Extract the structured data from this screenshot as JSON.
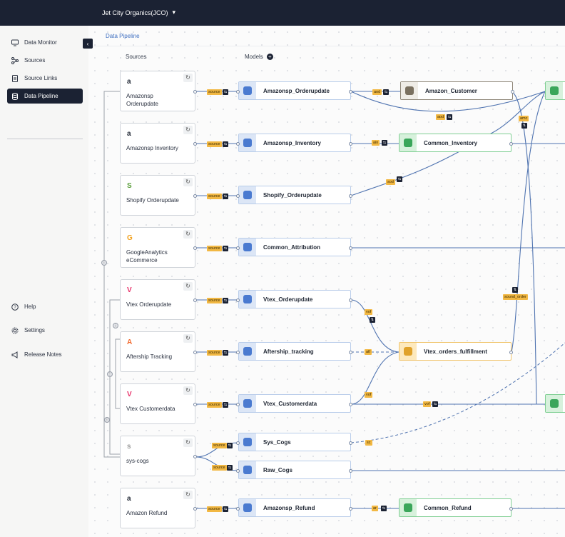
{
  "header": {
    "org_name": "Jet City Organics(JCO)"
  },
  "sidebar": {
    "items": [
      {
        "label": "Data Monitor",
        "icon": "monitor-icon"
      },
      {
        "label": "Sources",
        "icon": "sources-icon"
      },
      {
        "label": "Source Links",
        "icon": "document-icon"
      },
      {
        "label": "Data Pipeline",
        "icon": "database-icon",
        "active": true
      }
    ],
    "bottom": [
      {
        "label": "Help",
        "icon": "help-icon"
      },
      {
        "label": "Settings",
        "icon": "gear-icon"
      },
      {
        "label": "Release Notes",
        "icon": "megaphone-icon"
      }
    ]
  },
  "breadcrumb": "Data Pipeline",
  "columns": {
    "sources": "Sources",
    "models": "Models"
  },
  "sources": [
    {
      "name": "Amazonsp Orderupdate",
      "logo": "a"
    },
    {
      "name": "Amazonsp Inventory",
      "logo": "a"
    },
    {
      "name": "Shopify Orderupdate",
      "logo": "S"
    },
    {
      "name": "GoogleAnalytics eCommerce",
      "logo": "G"
    },
    {
      "name": "Vtex Orderupdate",
      "logo": "V"
    },
    {
      "name": "Aftership Tracking",
      "logo": "A"
    },
    {
      "name": "Vtex Customerdata",
      "logo": "V"
    },
    {
      "name": "sys-cogs",
      "logo": "s"
    },
    {
      "name": "Amazon Refund",
      "logo": "a"
    }
  ],
  "models": [
    "Amazonsp_Orderupdate",
    "Amazonsp_Inventory",
    "Shopify_Orderupdate",
    "Common_Attribution",
    "Vtex_Orderupdate",
    "Aftership_tracking",
    "Vtex_Customerdata",
    "Sys_Cogs",
    "Raw_Cogs",
    "Amazonsp_Refund"
  ],
  "downstream": {
    "amazon_customer": "Amazon_Customer",
    "common_inventory": "Common_Inventory",
    "vtex_orders_fulfillment": "Vtex_orders_fulfillment",
    "common_refund": "Common_Refund"
  },
  "tags": {
    "source": "source",
    "aod": "aod",
    "ain": "ain",
    "sod": "sod",
    "amc": "amc",
    "vof": "vof",
    "atf": "atf",
    "sc": "sc",
    "ar": "ar",
    "sound_order": "sound_order"
  },
  "colors": {
    "topbar": "#1b2233",
    "accent": "#f2b843",
    "link": "#3f6fc0"
  }
}
